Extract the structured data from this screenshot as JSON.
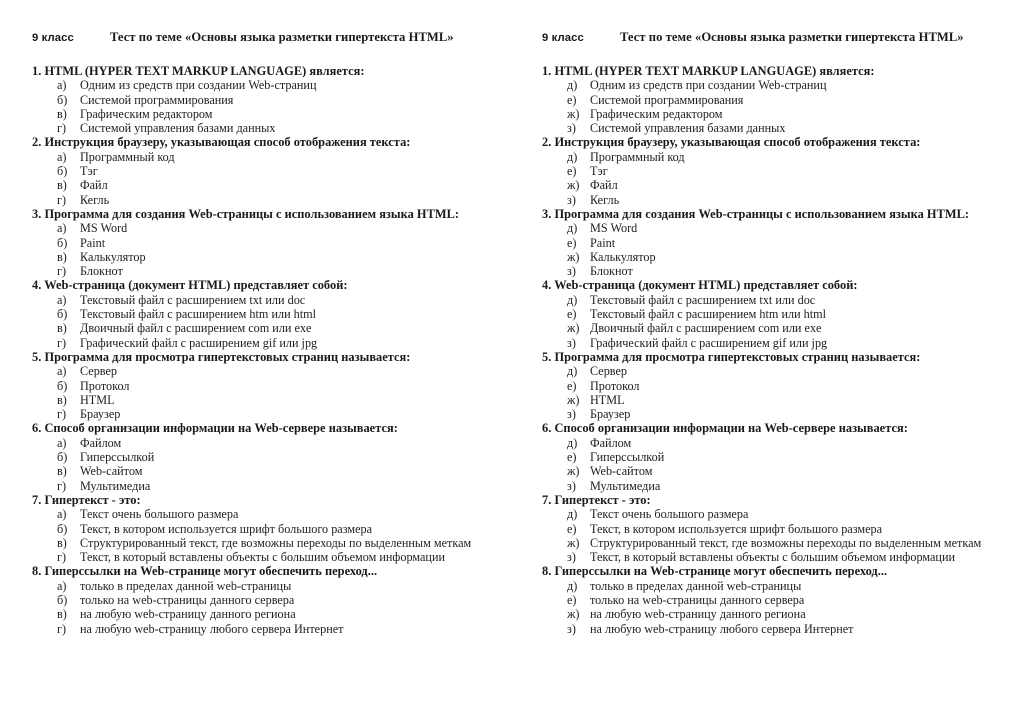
{
  "document": {
    "grade_label": "9 класс",
    "title": "Тест по теме «Основы языка разметки гипертекста HTML»"
  },
  "variants": [
    {
      "id": "variant-left",
      "letters": [
        "а)",
        "б)",
        "в)",
        "г)"
      ],
      "questions": [
        {
          "number": "1.",
          "text": "1. HTML (HYPER TEXT MARKUP LANGUAGE) является:",
          "options": [
            "Одним из средств при создании Web-страниц",
            "Системой программирования",
            "Графическим редактором",
            "Системой управления базами данных"
          ]
        },
        {
          "number": "2.",
          "text": "2. Инструкция браузеру, указывающая способ отображения текста:",
          "options": [
            "Программный код",
            "Тэг",
            "Файл",
            "Кегль"
          ]
        },
        {
          "number": "3.",
          "text": "3. Программа для создания Web-страницы с использованием языка HTML:",
          "options": [
            "MS Word",
            "Paint",
            "Калькулятор",
            "Блокнот"
          ]
        },
        {
          "number": "4.",
          "text": "4. Web-страница (документ HTML) представляет собой:",
          "options": [
            "Текстовый файл с расширением txt или doc",
            "Текстовый файл с расширением htm или html",
            "Двоичный файл с расширением com или exe",
            "Графический файл с расширением gif или jpg"
          ]
        },
        {
          "number": "5.",
          "text": "5. Программа для просмотра гипертекстовых страниц называется:",
          "options": [
            "Сервер",
            "Протокол",
            "HTML",
            "Браузер"
          ]
        },
        {
          "number": "6.",
          "text": "6. Способ организации информации на Web-сервере называется:",
          "options": [
            "Файлом",
            "Гиперссылкой",
            "Web-сайтом",
            "Мультимедиа"
          ]
        },
        {
          "number": "7.",
          "text": "7. Гипертекст - это:",
          "options": [
            "Текст очень большого размера",
            "Текст, в котором используется шрифт большого размера",
            "Структурированный текст, где возможны переходы по выделенным меткам",
            "Текст, в который вставлены объекты с большим объемом информации"
          ]
        },
        {
          "number": "8.",
          "text": "8. Гиперссылки на Web-странице могут обеспечить переход...",
          "options": [
            "только в пределах данной web-страницы",
            "только на web-страницы данного сервера",
            "на любую web-страницу данного региона",
            "на любую web-страницу любого сервера Интернет"
          ]
        }
      ]
    },
    {
      "id": "variant-right",
      "letters": [
        "д)",
        "е)",
        "ж)",
        "з)"
      ],
      "questions": [
        {
          "number": "1.",
          "text": "1. HTML (HYPER TEXT MARKUP LANGUAGE) является:",
          "options": [
            "Одним из средств при создании Web-страниц",
            "Системой программирования",
            "Графическим редактором",
            "Системой управления базами данных"
          ]
        },
        {
          "number": "2.",
          "text": "2. Инструкция браузеру, указывающая способ отображения текста:",
          "options": [
            "Программный код",
            "Тэг",
            "Файл",
            "Кегль"
          ]
        },
        {
          "number": "3.",
          "text": "3. Программа для создания Web-страницы с использованием языка HTML:",
          "options": [
            "MS Word",
            "Paint",
            "Калькулятор",
            "Блокнот"
          ]
        },
        {
          "number": "4.",
          "text": "4. Web-страница (документ HTML) представляет собой:",
          "options": [
            "Текстовый файл с расширением txt или doc",
            "Текстовый файл с расширением htm или html",
            "Двоичный файл с расширением com или exe",
            "Графический файл с расширением gif или jpg"
          ]
        },
        {
          "number": "5.",
          "text": "5. Программа для просмотра гипертекстовых страниц называется:",
          "options": [
            "Сервер",
            "Протокол",
            "HTML",
            "Браузер"
          ]
        },
        {
          "number": "6.",
          "text": "6. Способ организации информации на Web-сервере называется:",
          "options": [
            "Файлом",
            "Гиперссылкой",
            "Web-сайтом",
            "Мультимедиа"
          ]
        },
        {
          "number": "7.",
          "text": "7. Гипертекст - это:",
          "options": [
            "Текст очень большого размера",
            "Текст, в котором используется шрифт большого размера",
            "Структурированный текст, где возможны переходы по выделенным меткам",
            "Текст, в который вставлены объекты с большим объемом информации"
          ]
        },
        {
          "number": "8.",
          "text": "8. Гиперссылки на Web-странице могут обеспечить переход...",
          "options": [
            "только в пределах данной web-страницы",
            "только на web-страницы данного сервера",
            "на любую web-страницу данного региона",
            "на любую web-страницу любого сервера Интернет"
          ]
        }
      ]
    }
  ]
}
